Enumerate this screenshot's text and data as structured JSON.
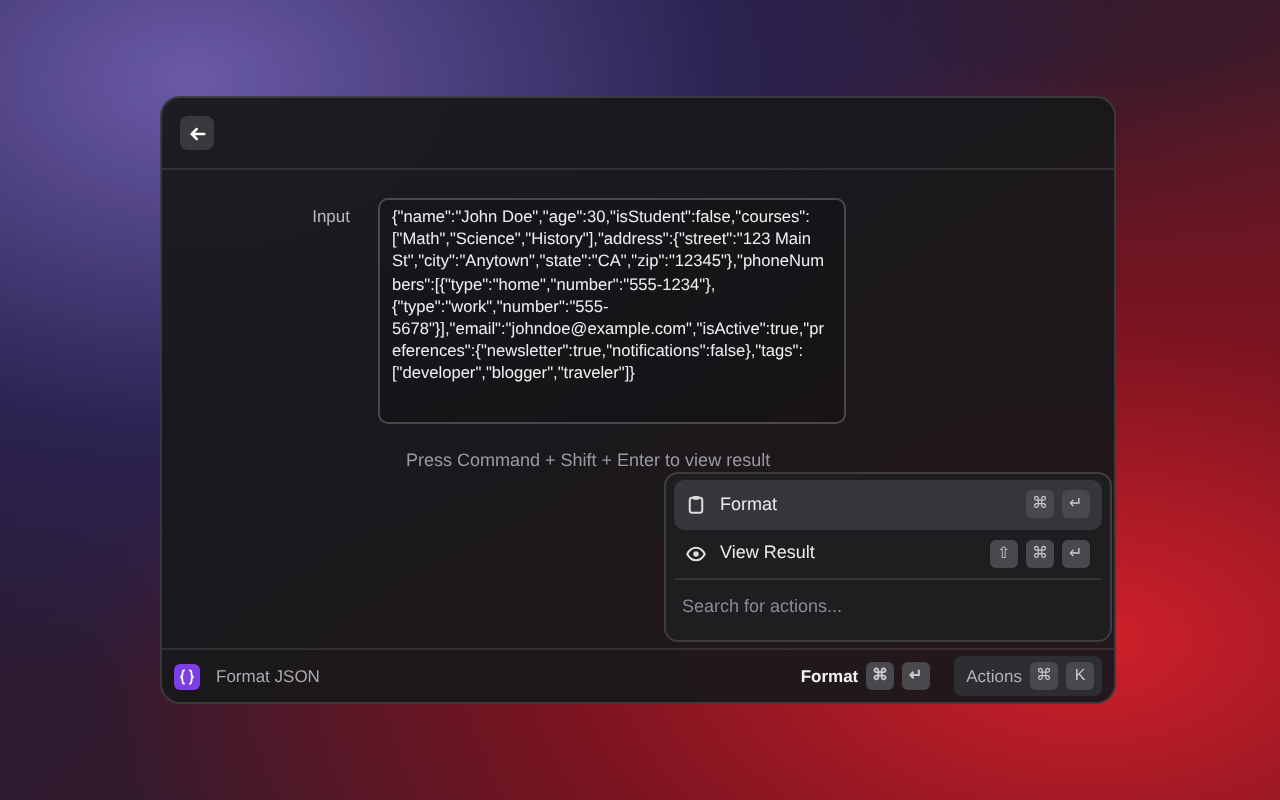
{
  "form": {
    "label": "Input",
    "value": "{\"name\":\"John Doe\",\"age\":30,\"isStudent\":false,\"courses\":[\"Math\",\"Science\",\"History\"],\"address\":{\"street\":\"123 Main St\",\"city\":\"Anytown\",\"state\":\"CA\",\"zip\":\"12345\"},\"phoneNumbers\":[{\"type\":\"home\",\"number\":\"555-1234\"},{\"type\":\"work\",\"number\":\"555-5678\"}],\"email\":\"johndoe@example.com\",\"isActive\":true,\"preferences\":{\"newsletter\":true,\"notifications\":false},\"tags\":[\"developer\",\"blogger\",\"traveler\"]}",
    "hint": "Press Command + Shift + Enter to view result"
  },
  "actions_menu": {
    "items": [
      {
        "kind": "clipboard",
        "label": "Format",
        "selected": true,
        "keys": [
          "⌘",
          "↵"
        ]
      },
      {
        "kind": "eye",
        "label": "View Result",
        "selected": false,
        "keys": [
          "⇧",
          "⌘",
          "↵"
        ]
      }
    ],
    "search": {
      "placeholder": "Search for actions..."
    }
  },
  "footer": {
    "title": "Format JSON",
    "primary_action": {
      "label": "Format",
      "keys": [
        "⌘",
        "↵"
      ]
    },
    "actions_button": {
      "label": "Actions",
      "keys": [
        "⌘",
        "K"
      ]
    }
  }
}
